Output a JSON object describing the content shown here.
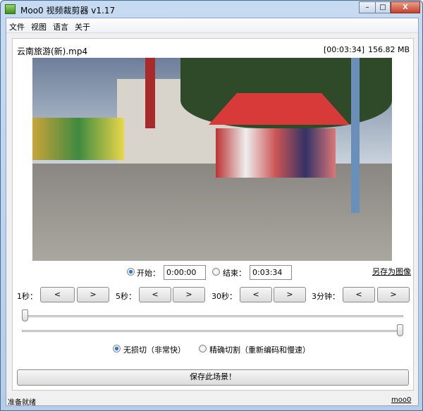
{
  "window": {
    "title": "Moo0 视频裁剪器 v1.17",
    "minimize": "–",
    "maximize": "□",
    "close": "X"
  },
  "menu": [
    "文件",
    "视图",
    "语言",
    "关于"
  ],
  "file": {
    "name": "云南旅游(新).mp4",
    "duration": "[00:03:34]",
    "size": "156.82 MB"
  },
  "range": {
    "start_label": "开始：",
    "start_value": "0:00:00",
    "end_label": "结束：",
    "end_value": "0:03:34",
    "selected": "start",
    "save_image": "另存为图像"
  },
  "steps": [
    {
      "label": "1秒："
    },
    {
      "label": "5秒："
    },
    {
      "label": "30秒："
    },
    {
      "label": "3分钟："
    }
  ],
  "step_buttons": {
    "back": "<",
    "forward": ">"
  },
  "sliders": {
    "start_fraction": 0,
    "end_fraction": 1
  },
  "modes": {
    "lossless": "无损切（非常快）",
    "precise": "精确切割（重新编码和慢速）",
    "selected": "lossless"
  },
  "save_button": "保存此场景！",
  "status": {
    "text": "准备就绪",
    "link": "moo0"
  }
}
